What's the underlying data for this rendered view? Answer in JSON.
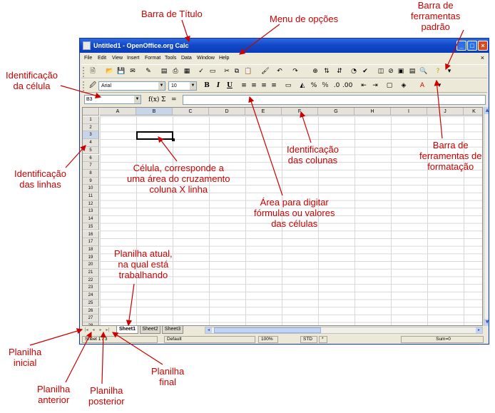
{
  "window": {
    "title": "Untitled1 - OpenOffice.org Calc",
    "controls": [
      "_",
      "□",
      "×"
    ],
    "doc_close": "×"
  },
  "menu": [
    "File",
    "Edit",
    "View",
    "Insert",
    "Format",
    "Tools",
    "Data",
    "Window",
    "Help"
  ],
  "standard_toolbar_icons": [
    "new-icon",
    "open-icon",
    "save-icon",
    "email-icon",
    "edit-file-icon",
    "pdf-icon",
    "print-icon",
    "page-preview-icon",
    "spellcheck-icon",
    "autospell-icon",
    "cut-icon",
    "copy-icon",
    "paste-icon",
    "format-paintbrush-icon",
    "undo-icon",
    "redo-icon",
    "hyperlink-icon",
    "sort-ascending-icon",
    "sort-descending-icon",
    "chart-icon",
    "draw-functions-icon",
    "navigator-icon",
    "gallery-icon",
    "datasources-icon",
    "zoom-icon",
    "help-icon"
  ],
  "formatting": {
    "font_name": "Arial",
    "font_size": "10",
    "bold": "B",
    "italic": "I",
    "underline": "U"
  },
  "formula_bar": {
    "name_box": "B3",
    "function_wizard": "f(x)",
    "sum": "Σ",
    "equals": "="
  },
  "columns": [
    "A",
    "B",
    "C",
    "D",
    "E",
    "F",
    "G",
    "H",
    "I",
    "J",
    "K"
  ],
  "rows": [
    "1",
    "2",
    "3",
    "4",
    "5",
    "6",
    "7",
    "8",
    "9",
    "10",
    "11",
    "12",
    "13",
    "14",
    "15",
    "16",
    "17",
    "18",
    "19",
    "20",
    "21",
    "22",
    "23",
    "24",
    "25",
    "26",
    "27",
    "28"
  ],
  "selected_cell": {
    "column": "B",
    "row": "3"
  },
  "sheet_tabs": [
    "Sheet1",
    "Sheet2",
    "Sheet3"
  ],
  "active_sheet": "Sheet1",
  "status_bar": {
    "sheet": "Sheet 1 / 3",
    "page_style": "Default",
    "zoom": "100%",
    "mode": "STD",
    "modified": "*",
    "sum": "Sum=0"
  },
  "annotations": {
    "title_bar": [
      "Barra de Título"
    ],
    "menu": [
      "Menu de opções"
    ],
    "standard_toolbar": [
      "Barra de",
      "ferramentas",
      "padrão"
    ],
    "cell_id": [
      "Identificação",
      "da célula"
    ],
    "row_id": [
      "Identificação",
      "das linhas"
    ],
    "cell": [
      "Célula, corresponde a",
      "uma área do cruzamento",
      "coluna X linha"
    ],
    "column_id": [
      "Identificação",
      "das colunas"
    ],
    "formatting_toolbar": [
      "Barra de",
      "ferramentas de",
      "formatação"
    ],
    "formula_area": [
      "Área para digitar",
      "fórmulas ou valores",
      "das células"
    ],
    "current_sheet": [
      "Planilha atual,",
      "na qual está",
      "trabalhando"
    ],
    "first_sheet": [
      "Planilha",
      "inicial"
    ],
    "previous_sheet": [
      "Planilha",
      "anterior"
    ],
    "next_sheet": [
      "Planilha",
      "posterior"
    ],
    "last_sheet": [
      "Planilha",
      "final"
    ]
  }
}
